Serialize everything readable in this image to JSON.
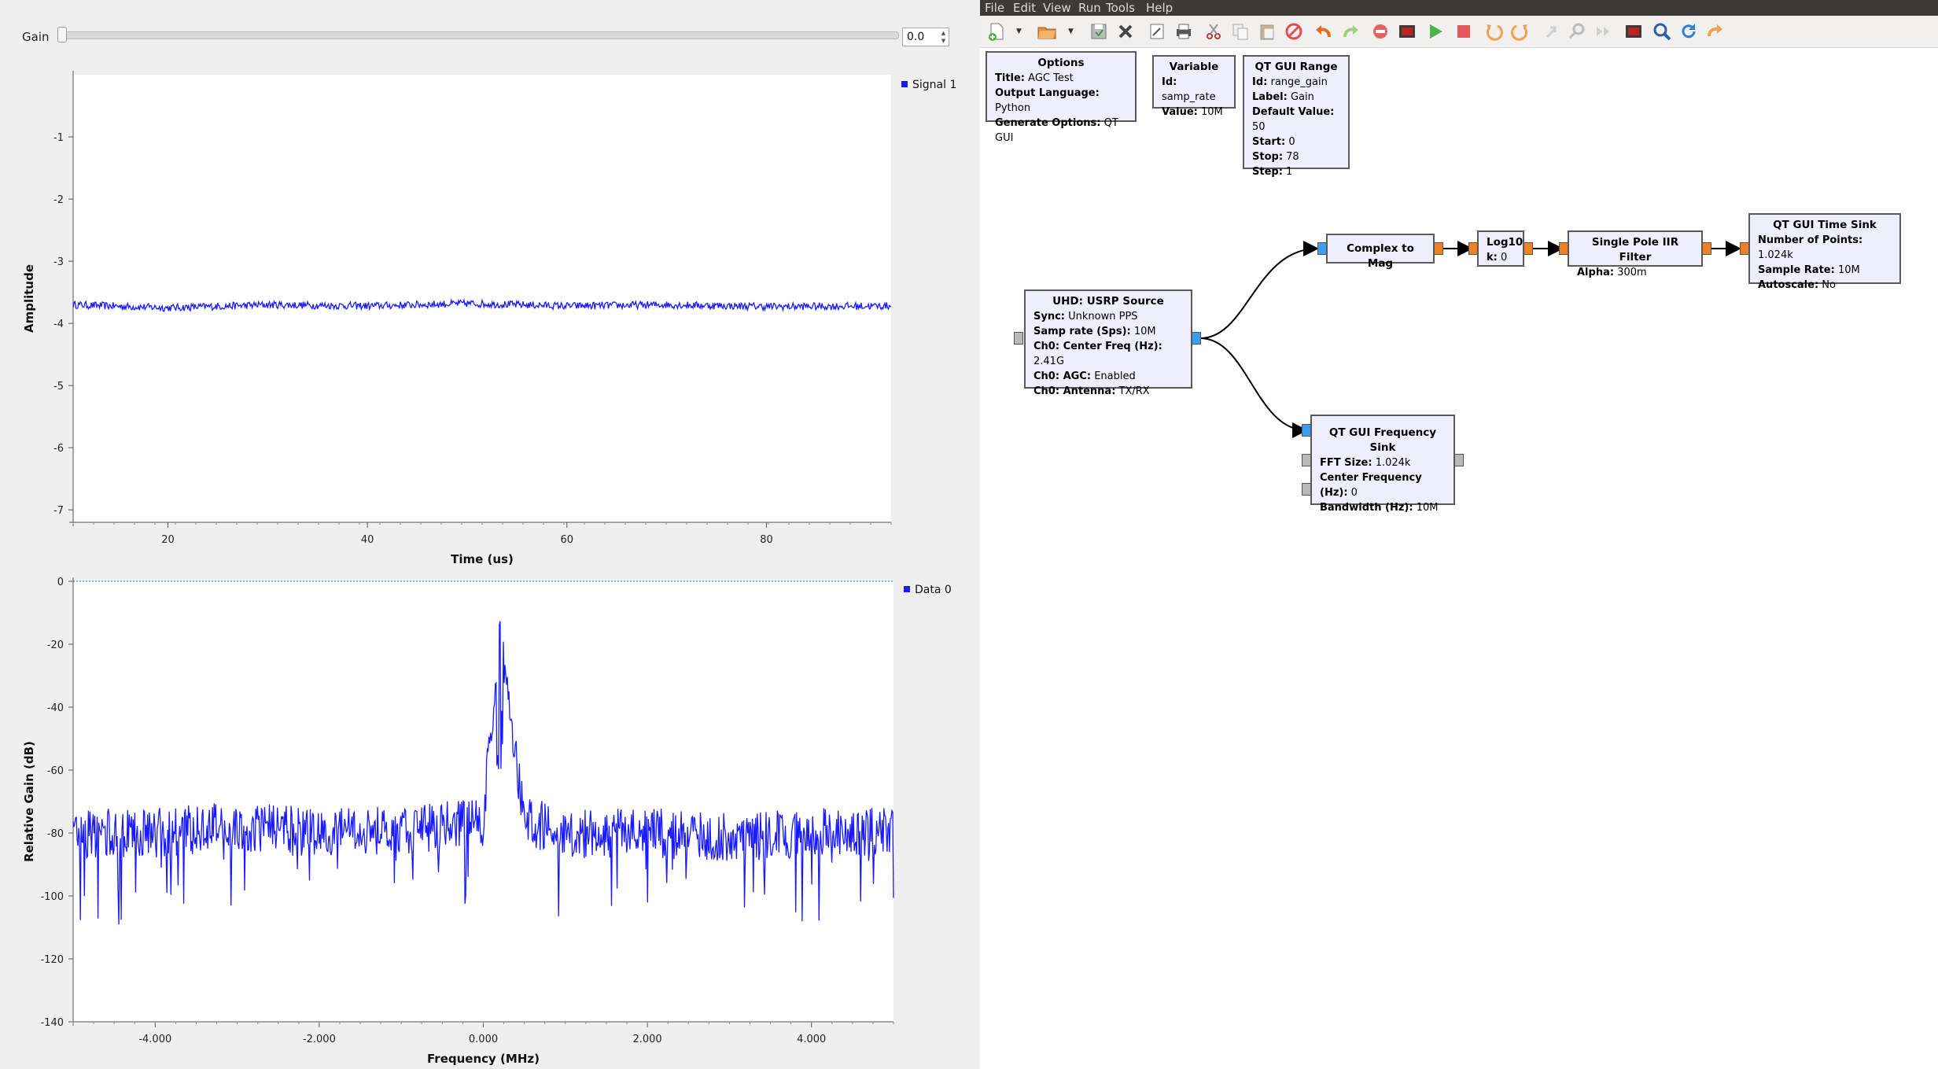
{
  "left": {
    "gain": {
      "label": "Gain",
      "value": "0.0"
    },
    "time_plot": {
      "legend": "Signal 1",
      "ylabel": "Amplitude",
      "xlabel": "Time (us)",
      "y_ticks": [
        "-1",
        "-2",
        "-3",
        "-4",
        "-5",
        "-6",
        "-7"
      ],
      "x_ticks": [
        "20",
        "40",
        "60",
        "80"
      ]
    },
    "freq_plot": {
      "legend": "Data 0",
      "ylabel": "Relative Gain (dB)",
      "xlabel": "Frequency (MHz)",
      "y_ticks": [
        "0",
        "-20",
        "-40",
        "-60",
        "-80",
        "-100",
        "-120",
        "-140"
      ],
      "x_ticks": [
        "-4.000",
        "-2.000",
        "0.000",
        "2.000",
        "4.000"
      ]
    }
  },
  "chart_data": [
    {
      "type": "line",
      "x": [
        10.5,
        20,
        30,
        40,
        50,
        60,
        70,
        80,
        92
      ],
      "series": [
        {
          "name": "Signal 1",
          "values": [
            -3.7,
            -3.75,
            -3.7,
            -3.72,
            -3.68,
            -3.72,
            -3.7,
            -3.73,
            -3.72
          ]
        }
      ],
      "xlabel": "Time (us)",
      "ylabel": "Amplitude",
      "xlim": [
        10.5,
        92.5
      ],
      "ylim": [
        -7.2,
        -0.0
      ],
      "legend": "top-right",
      "color": "#1a1aff"
    },
    {
      "type": "line",
      "x": [
        -5,
        -4,
        -3,
        -2,
        -1,
        0,
        0.2,
        0.5,
        1,
        2,
        3,
        4,
        5
      ],
      "series": [
        {
          "name": "Data 0",
          "values": [
            -80,
            -80,
            -78,
            -80,
            -79,
            -77,
            -13,
            -76,
            -80,
            -80,
            -81,
            -80,
            -80
          ]
        }
      ],
      "reference_line": 0,
      "xlabel": "Frequency (MHz)",
      "ylabel": "Relative Gain (dB)",
      "xlim": [
        -5,
        5
      ],
      "ylim": [
        -140,
        0
      ],
      "legend": "top-right",
      "color": "#1a1aff"
    }
  ],
  "grc": {
    "menu": [
      "File",
      "Edit",
      "View",
      "Run",
      "Tools",
      "Help"
    ],
    "toolbar_icons": [
      "new-icon",
      "open-icon",
      "save-icon",
      "close-icon",
      "properties-icon",
      "print-icon",
      "cut-icon",
      "copy-icon",
      "paste-icon",
      "delete-icon",
      "undo-icon",
      "redo-icon",
      "disable-icon",
      "generate-icon",
      "execute-icon",
      "kill-icon",
      "rotate-ccw-icon",
      "rotate-cw-icon",
      "enable-icon",
      "find-icon",
      "bypass-icon",
      "screenshot-icon",
      "search-icon",
      "reload-icon",
      "more-icon"
    ],
    "blocks": {
      "options": {
        "title": "Options",
        "rows": [
          [
            "Title:",
            "AGC Test"
          ],
          [
            "Output Language:",
            "Python"
          ],
          [
            "Generate Options:",
            "QT GUI"
          ]
        ]
      },
      "variable": {
        "title": "Variable",
        "rows": [
          [
            "Id:",
            "samp_rate"
          ],
          [
            "Value:",
            "10M"
          ]
        ]
      },
      "range": {
        "title": "QT GUI Range",
        "rows": [
          [
            "Id:",
            "range_gain"
          ],
          [
            "Label:",
            "Gain"
          ],
          [
            "Default Value:",
            "50"
          ],
          [
            "Start:",
            "0"
          ],
          [
            "Stop:",
            "78"
          ],
          [
            "Step:",
            "1"
          ]
        ]
      },
      "usrp": {
        "title": "UHD: USRP Source",
        "rows": [
          [
            "Sync:",
            "Unknown PPS"
          ],
          [
            "Samp rate (Sps):",
            "10M"
          ],
          [
            "Ch0: Center Freq (Hz):",
            "2.41G"
          ],
          [
            "Ch0: AGC:",
            "Enabled"
          ],
          [
            "Ch0: Antenna:",
            "TX/RX"
          ]
        ]
      },
      "c2mag": {
        "title": "Complex to Mag",
        "rows": []
      },
      "log10": {
        "title": "Log10",
        "rows": [
          [
            "k:",
            "0"
          ]
        ]
      },
      "iir": {
        "title": "Single Pole IIR Filter",
        "rows": [
          [
            "Alpha:",
            "300m"
          ]
        ]
      },
      "timesink": {
        "title": "QT GUI Time Sink",
        "rows": [
          [
            "Number of Points:",
            "1.024k"
          ],
          [
            "Sample Rate:",
            "10M"
          ],
          [
            "Autoscale:",
            "No"
          ]
        ]
      },
      "freqsink": {
        "title": "QT GUI Frequency Sink",
        "rows": [
          [
            "FFT Size:",
            "1.024k"
          ],
          [
            "Center Frequency (Hz):",
            "0"
          ],
          [
            "Bandwidth (Hz):",
            "10M"
          ]
        ]
      }
    }
  }
}
